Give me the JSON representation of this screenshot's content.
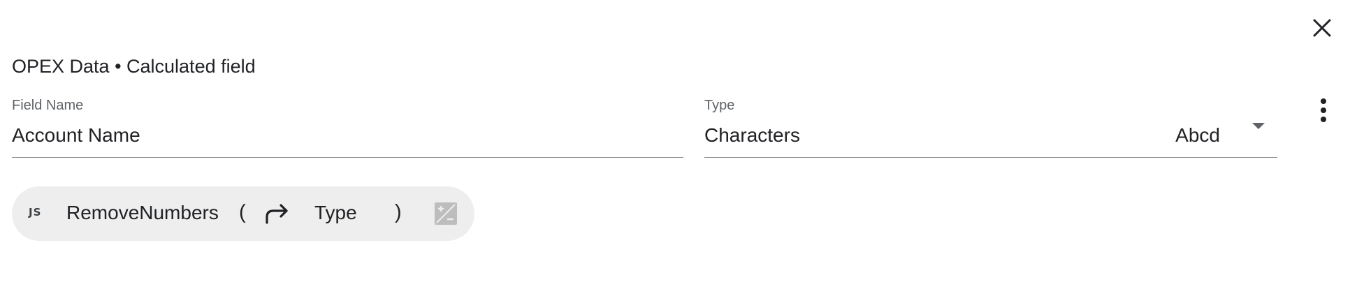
{
  "header": {
    "title": "OPEX Data • Calculated field"
  },
  "icons": {
    "close": "close-icon",
    "more": "more-vert-icon",
    "arg": "redo-arrow-icon",
    "calc": "plus-minus-box-icon"
  },
  "fields": {
    "name": {
      "label": "Field Name",
      "value": "Account Name"
    },
    "type": {
      "label": "Type",
      "value": "Characters",
      "sample": "Abcd"
    }
  },
  "formula": {
    "badge": "JS",
    "function_name": "RemoveNumbers",
    "open_paren": "(",
    "argument": "Type",
    "close_paren": ")"
  },
  "colors": {
    "chip_background": "#eeeeee",
    "label": "#5f6368",
    "text": "#202124",
    "underline": "#8a8a8a"
  }
}
